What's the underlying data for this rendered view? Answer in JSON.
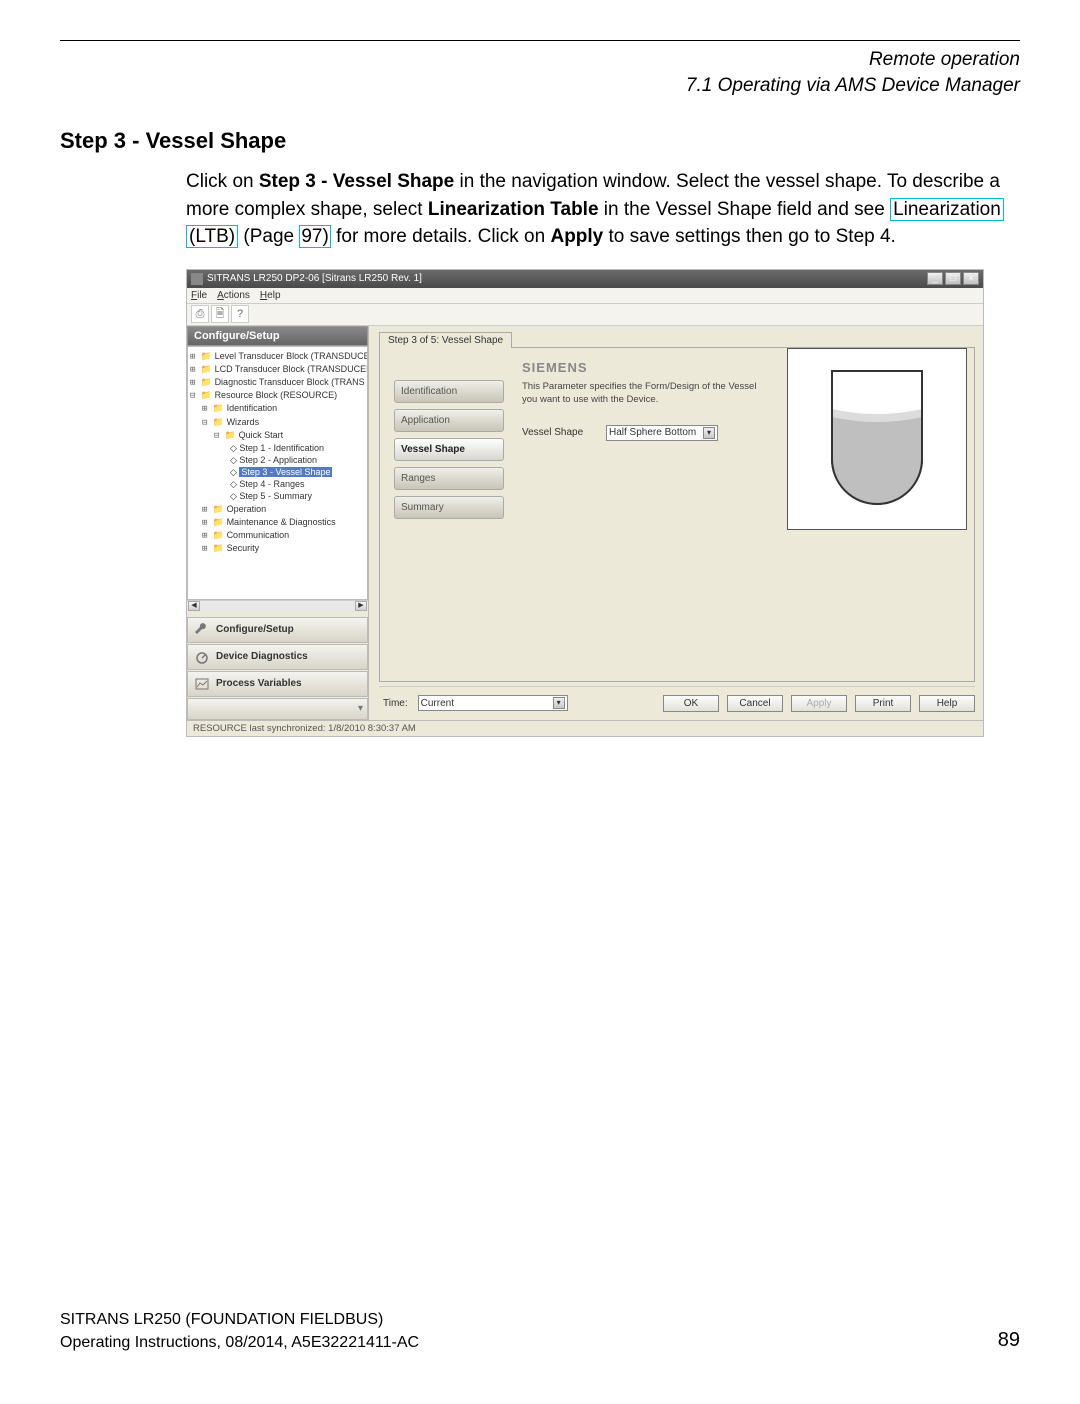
{
  "header": {
    "chapter": "Remote operation",
    "section": "7.1 Operating via AMS Device Manager"
  },
  "heading": "Step 3 - Vessel Shape",
  "para": {
    "t1": "Click on ",
    "b1": "Step 3 - Vessel Shape",
    "t2": " in the navigation window. Select the vessel shape. To describe a more complex shape, select ",
    "b2": "Linearization Table",
    "t3": " in the Vessel Shape field and see ",
    "link1a": "Linearization",
    "link1b": "(LTB)",
    "t4": " (Page ",
    "link2": "97)",
    "t5": " for more details. Click on ",
    "b3": "Apply",
    "t6": " to save settings then go to Step 4."
  },
  "window": {
    "title": "SITRANS LR250   DP2-06 [Sitrans LR250 Rev. 1]",
    "menu": {
      "file": "File",
      "actions": "Actions",
      "help": "Help"
    },
    "nav": {
      "header": "Configure/Setup",
      "tree": {
        "n0": "Level Transducer Block (TRANSDUCE",
        "n1": "LCD Transducer Block (TRANSDUCER",
        "n2": "Diagnostic Transducer Block (TRANS",
        "n3": "Resource Block (RESOURCE)",
        "n4": "Identification",
        "n5": "Wizards",
        "n6": "Quick Start",
        "n7": "Step 1 - Identification",
        "n8": "Step 2 - Application",
        "n9": "Step 3 - Vessel Shape",
        "n10": "Step 4 - Ranges",
        "n11": "Step 5 - Summary",
        "n12": "Operation",
        "n13": "Maintenance & Diagnostics",
        "n14": "Communication",
        "n15": "Security"
      },
      "buttons": {
        "b1": "Configure/Setup",
        "b2": "Device Diagnostics",
        "b3": "Process Variables"
      }
    },
    "tab": "Step 3 of 5: Vessel Shape",
    "steps": {
      "s1": "Identification",
      "s2": "Application",
      "s3": "Vessel Shape",
      "s4": "Ranges",
      "s5": "Summary"
    },
    "brand": "SIEMENS",
    "desc": "This Parameter specifies the Form/Design of the Vessel you want to use with the Device.",
    "field": {
      "label": "Vessel Shape",
      "value": "Half Sphere Bottom"
    },
    "time": {
      "label": "Time:",
      "value": "Current"
    },
    "dlg": {
      "ok": "OK",
      "cancel": "Cancel",
      "apply": "Apply",
      "print": "Print",
      "help": "Help"
    },
    "status": "RESOURCE last synchronized: 1/8/2010 8:30:37 AM"
  },
  "footer": {
    "product": "SITRANS LR250 (FOUNDATION FIELDBUS)",
    "docinfo": "Operating Instructions, 08/2014, A5E32221411-AC",
    "page": "89"
  }
}
